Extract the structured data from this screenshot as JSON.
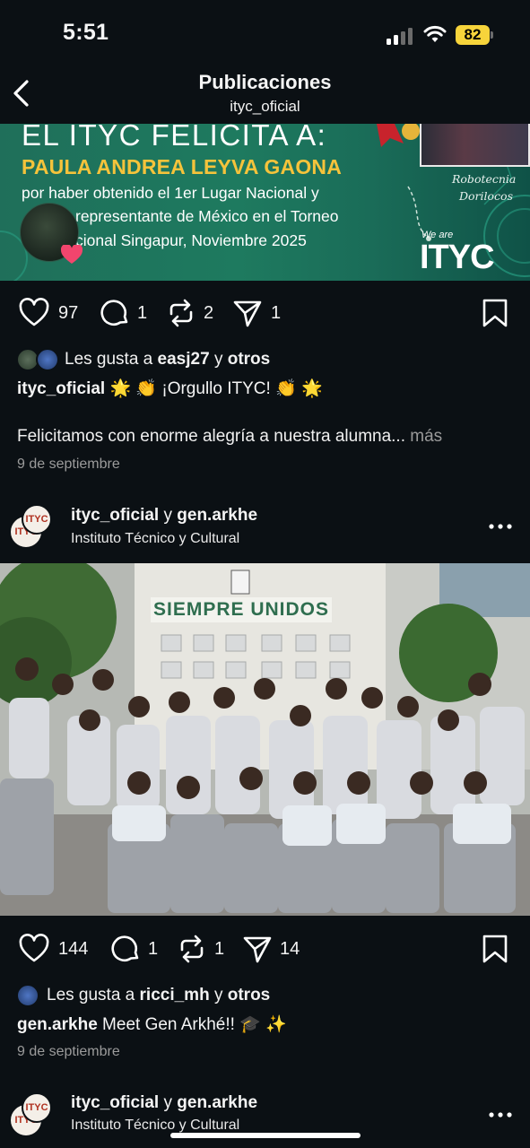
{
  "status": {
    "time": "5:51",
    "battery": "82"
  },
  "header": {
    "title": "Publicaciones",
    "subtitle": "ityc_oficial"
  },
  "banner": {
    "line1": "EL ITYC FELICITA A:",
    "line2": "PAULA ANDREA LEYVA GAONA",
    "line3": "por haber obtenido el 1er Lugar Nacional y",
    "line4": "representante de México en el Torneo",
    "line5": "cional Singapur, Noviembre 2025",
    "robo1": "Robotecnia",
    "robo2": "Dorilocos",
    "weare": "We are",
    "logo": "ITYC"
  },
  "post1": {
    "likes": "97",
    "comments": "1",
    "reposts": "2",
    "shares": "1",
    "liked_by_prefix": "Les gusta a",
    "liked_by_user": "easj27",
    "liked_by_join": "y",
    "liked_by_others": "otros",
    "caption_user": "ityc_oficial",
    "caption_text": "🌟 👏 ¡Orgullo ITYC! 👏 🌟",
    "description": "Felicitamos con enorme alegría a nuestra alumna...",
    "more": "más",
    "date": "9 de septiembre"
  },
  "post2": {
    "user1": "ityc_oficial",
    "join": "y",
    "user2": "gen.arkhe",
    "location": "Instituto Técnico y Cultural",
    "photo_sign": "SIEMPRE UNIDOS",
    "likes": "144",
    "comments": "1",
    "reposts": "1",
    "shares": "14",
    "liked_by_prefix": "Les gusta a",
    "liked_by_user": "ricci_mh",
    "liked_by_join": "y",
    "liked_by_others": "otros",
    "caption_user": "gen.arkhe",
    "caption_text": "Meet Gen Arkhé!! 🎓 ✨",
    "date": "9 de septiembre"
  },
  "post3": {
    "user1": "ityc_oficial",
    "join": "y",
    "user2": "gen.arkhe",
    "location": "Instituto Técnico y Cultural"
  },
  "avatar_text": "ITYC"
}
